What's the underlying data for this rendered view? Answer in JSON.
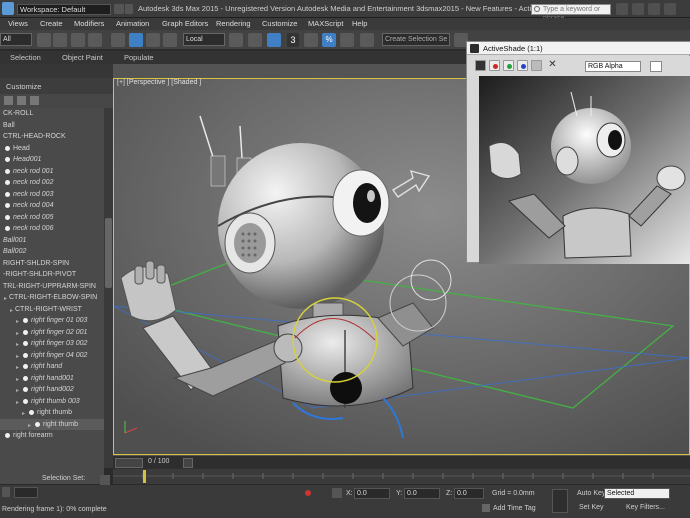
{
  "titlebar": {
    "workspace": "Workspace: Default",
    "title": "Autodesk 3ds Max 2015  -  Unregistered Version      Autodesk Media and Entertainment 3dsmax2015 - New Features - ActiveShade.max",
    "search_placeholder": "Type a keyword or phrase"
  },
  "menu": [
    "Views",
    "Create",
    "Modifiers",
    "Animation",
    "Graph Editors",
    "Rendering",
    "Customize",
    "MAXScript",
    "Help"
  ],
  "toolbar": {
    "selection_filter": "All",
    "ref_coord": "Local",
    "num_3": "3",
    "pct": "%",
    "named_selection": "Create Selection Se"
  },
  "ribbon_tabs": [
    "Selection",
    "Object Paint",
    "Populate"
  ],
  "left_panel": {
    "title": "Customize",
    "scene_items": [
      {
        "label": "CK-ROLL",
        "indent": 0,
        "italic": false,
        "bulb": false
      },
      {
        "label": "Ball",
        "indent": 0,
        "italic": false,
        "bulb": false
      },
      {
        "label": "CTRL-HEAD-ROCK",
        "indent": 0,
        "italic": false,
        "bulb": false
      },
      {
        "label": "Head",
        "indent": 0,
        "italic": false,
        "bulb": true
      },
      {
        "label": "Head001",
        "indent": 0,
        "italic": true,
        "bulb": true
      },
      {
        "label": "neck rod 001",
        "indent": 0,
        "italic": true,
        "bulb": true
      },
      {
        "label": "neck rod 002",
        "indent": 0,
        "italic": true,
        "bulb": true
      },
      {
        "label": "neck rod 003",
        "indent": 0,
        "italic": true,
        "bulb": true
      },
      {
        "label": "neck rod 004",
        "indent": 0,
        "italic": true,
        "bulb": true
      },
      {
        "label": "neck rod 005",
        "indent": 0,
        "italic": true,
        "bulb": true
      },
      {
        "label": "neck rod 006",
        "indent": 0,
        "italic": true,
        "bulb": true
      },
      {
        "label": "Ball001",
        "indent": 0,
        "italic": true,
        "bulb": false
      },
      {
        "label": "Ball002",
        "indent": 0,
        "italic": true,
        "bulb": false
      },
      {
        "label": "RIGHT-SHLDR-SPIN",
        "indent": 0,
        "italic": false,
        "bulb": false
      },
      {
        "label": "-RIGHT-SHLDR-PIVOT",
        "indent": 0,
        "italic": false,
        "bulb": false
      },
      {
        "label": "TRL-RIGHT-UPPRARM-SPIN",
        "indent": 0,
        "italic": false,
        "bulb": false
      },
      {
        "label": "CTRL-RIGHT-ELBOW-SPIN",
        "indent": 1,
        "italic": false,
        "bulb": false
      },
      {
        "label": "CTRL-RIGHT-WRIST",
        "indent": 2,
        "italic": false,
        "bulb": false
      },
      {
        "label": "right finger 01 003",
        "indent": 3,
        "italic": true,
        "bulb": true
      },
      {
        "label": "right finger 02 001",
        "indent": 3,
        "italic": true,
        "bulb": true
      },
      {
        "label": "right finger 03 002",
        "indent": 3,
        "italic": true,
        "bulb": true
      },
      {
        "label": "right finger 04 002",
        "indent": 3,
        "italic": true,
        "bulb": true
      },
      {
        "label": "right hand",
        "indent": 3,
        "italic": true,
        "bulb": true
      },
      {
        "label": "right hand001",
        "indent": 3,
        "italic": true,
        "bulb": true
      },
      {
        "label": "right hand002",
        "indent": 3,
        "italic": true,
        "bulb": true
      },
      {
        "label": "right thumb 003",
        "indent": 3,
        "italic": true,
        "bulb": true
      },
      {
        "label": "right thumb",
        "indent": 4,
        "italic": false,
        "bulb": true
      },
      {
        "label": "right thumb",
        "indent": 5,
        "italic": false,
        "bulb": true,
        "highlight": true
      },
      {
        "label": "right forearm",
        "indent": 0,
        "italic": false,
        "bulb": true
      }
    ],
    "selection_set_label": "Selection Set:"
  },
  "viewport": {
    "label": "[+] [Perspective ] [Shaded ]"
  },
  "activeshade": {
    "title": "ActiveShade (1:1)",
    "channel": "RGB Alpha",
    "colors": {
      "red": "#d22424",
      "green": "#23a33c",
      "blue": "#2742c8"
    }
  },
  "timeline": {
    "frame_counter": "0 / 100"
  },
  "status": {
    "prompt": "Rendering frame 1): 0% complete",
    "x_label": "X:",
    "x": "0.0",
    "y_label": "Y:",
    "y": "0.0",
    "z_label": "Z:",
    "z": "0.0",
    "grid": "Grid = 0.0mm",
    "add_time_tag": "Add Time Tag",
    "auto_key": "Auto Key",
    "set_key": "Set Key",
    "key_selected": "Selected",
    "key_filters": "Key Filters..."
  }
}
